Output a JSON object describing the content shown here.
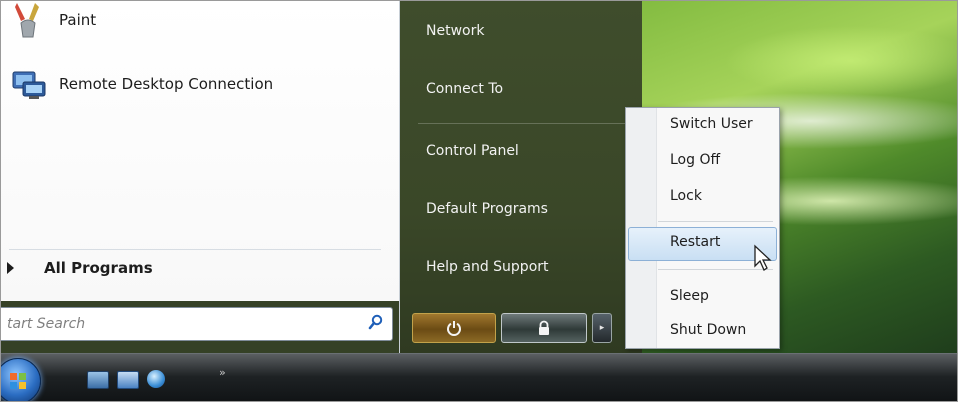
{
  "left_pane": {
    "programs": [
      {
        "label": "Paint",
        "icon": "paint-icon"
      },
      {
        "label": "Remote Desktop Connection",
        "icon": "remote-desktop-icon"
      }
    ],
    "all_programs_label": "All Programs",
    "search_placeholder": "tart Search"
  },
  "right_pane": {
    "links": [
      "Network",
      "Connect To",
      "Control Panel",
      "Default Programs",
      "Help and Support"
    ]
  },
  "power_menu": {
    "items": [
      "Switch User",
      "Log Off",
      "Lock",
      "Restart",
      "Sleep",
      "Shut Down"
    ],
    "hovered": "Restart"
  },
  "colors": {
    "accent_hover": "#c9dff3",
    "right_pane_bg": "#3f4d2c",
    "power_button": "#8c6a25"
  },
  "icons": [
    "paint-icon",
    "remote-desktop-icon",
    "search-icon",
    "power-icon",
    "lock-icon",
    "chevron-right-icon",
    "start-orb-icon"
  ]
}
